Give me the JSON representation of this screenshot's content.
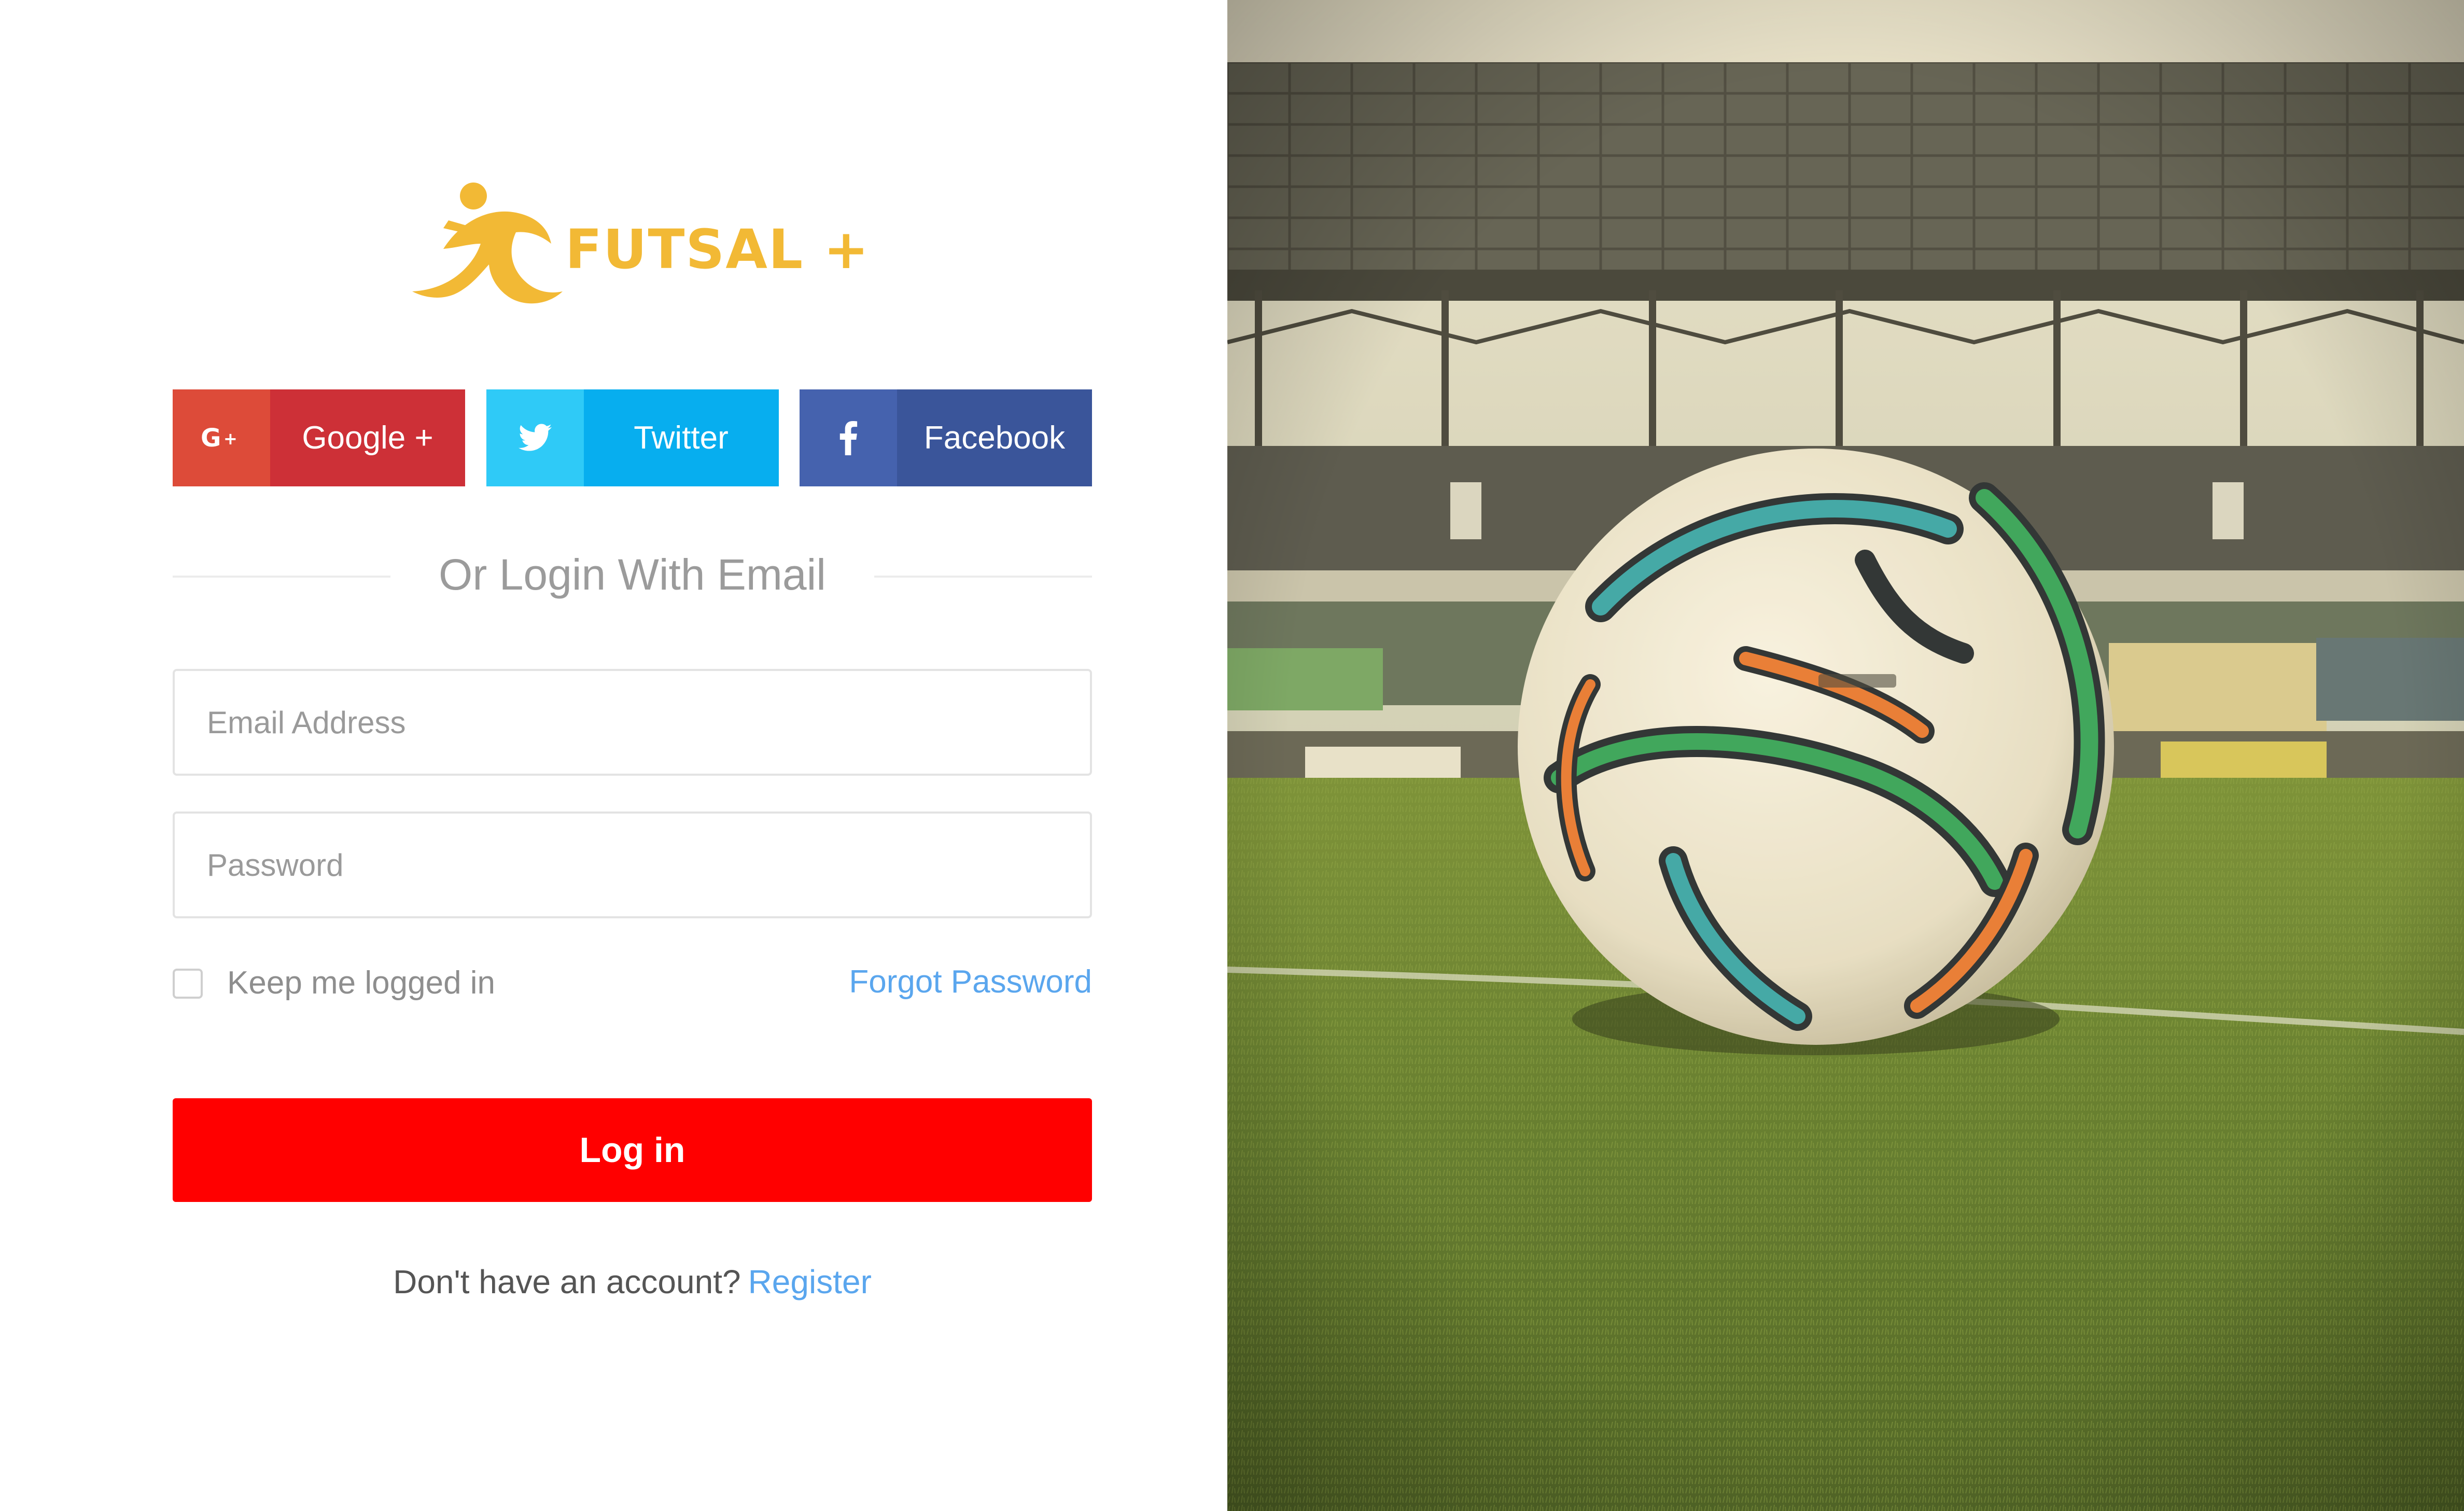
{
  "brand": {
    "name": "FUTSAL +",
    "color": "#f2b935"
  },
  "social": [
    {
      "label": "Google +",
      "icon": "google-plus-icon",
      "icon_glyph": "G+"
    },
    {
      "label": "Twitter",
      "icon": "twitter-bird-icon"
    },
    {
      "label": "Facebook",
      "icon": "facebook-f-icon",
      "icon_glyph": "f"
    }
  ],
  "divider": {
    "text": "Or Login With Email"
  },
  "form": {
    "email_placeholder": "Email Address",
    "password_placeholder": "Password",
    "keep_logged_in_label": "Keep me logged in",
    "keep_logged_in_checked": false,
    "forgot_password_label": "Forgot Password",
    "login_label": "Log in"
  },
  "register": {
    "prompt": "Don't have an account?",
    "link_label": "Register"
  },
  "colors": {
    "login_button": "#ff0000",
    "link": "#5aa6ee",
    "google": "#cd3037",
    "twitter": "#07aeef",
    "facebook": "#3a559a"
  },
  "hero": {
    "description_icon": "soccer-ball-stadium-photo"
  }
}
